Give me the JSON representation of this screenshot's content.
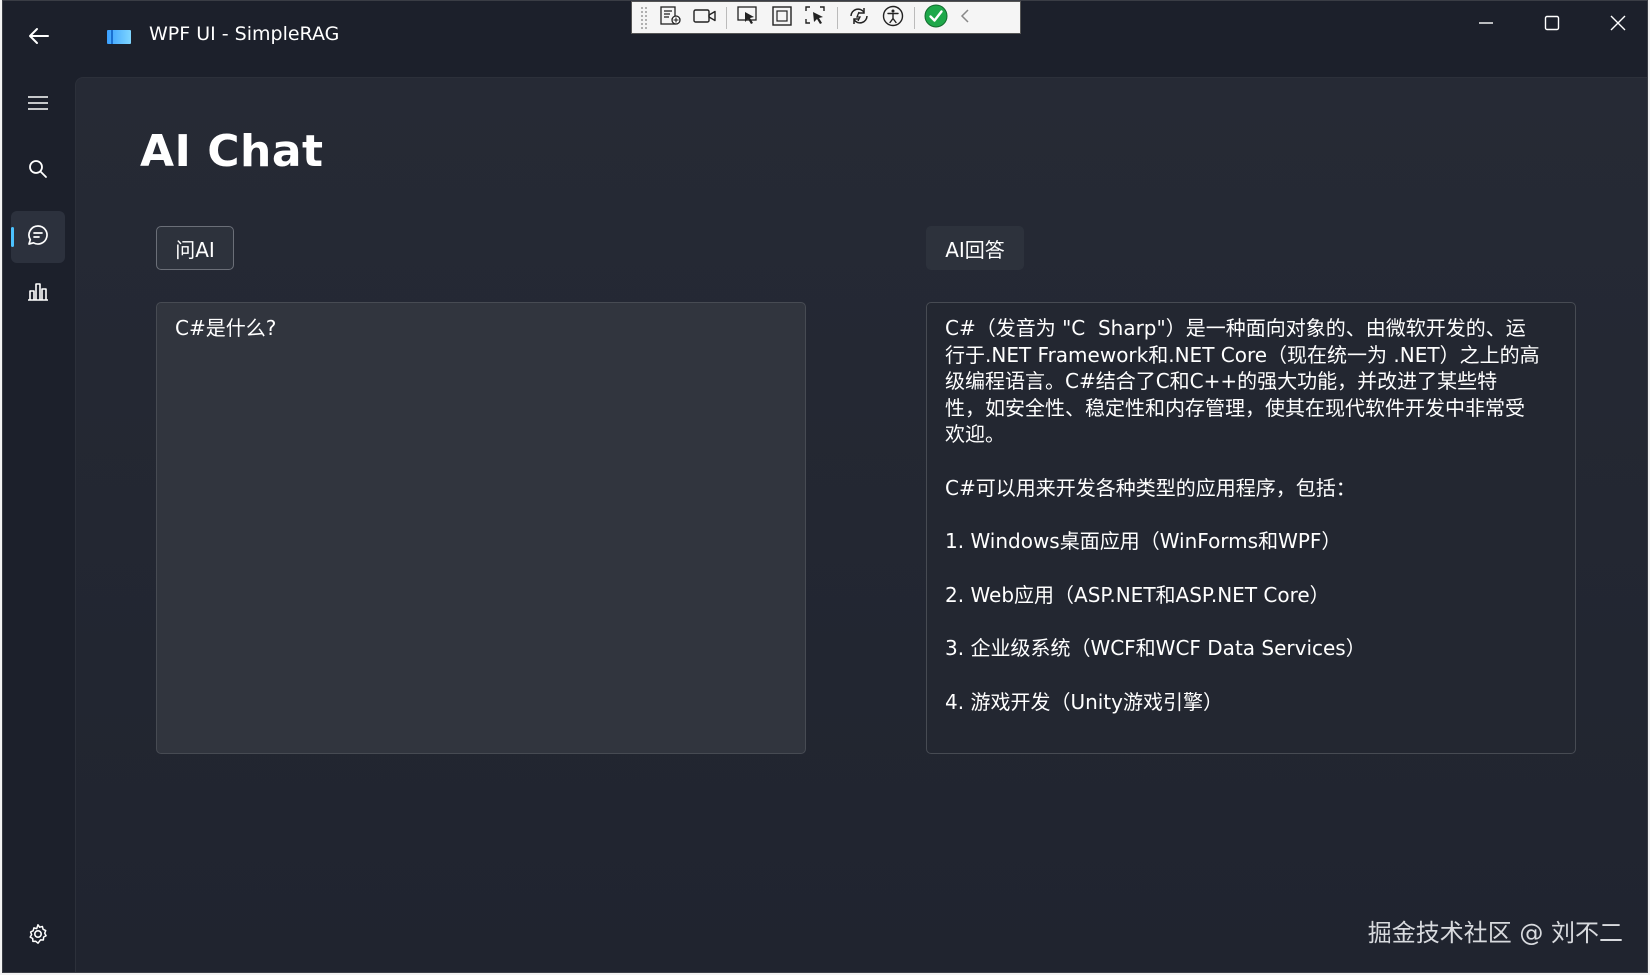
{
  "window": {
    "title": "WPF UI - SimpleRAG"
  },
  "titlebar": {
    "back_icon": "arrow-left-icon",
    "logo_icon": "app-logo-icon",
    "minimize_icon": "minimize-icon",
    "maximize_icon": "maximize-icon",
    "close_icon": "close-icon"
  },
  "debug_toolbar": {
    "items": [
      "live-visual-tree-icon",
      "record-icon",
      "select-element-icon",
      "display-layout-adorners-icon",
      "track-focused-element-icon",
      "hot-reload-icon",
      "accessibility-icon",
      "status-ok-icon",
      "collapse-chevron-icon"
    ]
  },
  "navigation": {
    "items": [
      {
        "icon": "hamburger-menu-icon",
        "active": false
      },
      {
        "icon": "search-icon",
        "active": false
      },
      {
        "icon": "chat-icon",
        "active": true
      },
      {
        "icon": "bar-chart-icon",
        "active": false
      }
    ],
    "footer_icon": "settings-gear-icon"
  },
  "page": {
    "title": "AI Chat",
    "ask_button_label": "问AI",
    "answer_button_label": "AI回答",
    "question_text": "C#是什么?",
    "answer_lines": [
      "C#（发音为 \"C  Sharp\"）是一种面向对象的、由微软开发的、运",
      "行于.NET Framework和.NET Core（现在统一为 .NET）之上的高",
      "级编程语言。C#结合了C和C++的强大功能，并改进了某些特",
      "性，如安全性、稳定性和内存管理，使其在现代软件开发中非常受",
      "欢迎。",
      "",
      "C#可以用来开发各种类型的应用程序，包括：",
      "",
      "1. Windows桌面应用（WinForms和WPF）",
      "",
      "2. Web应用（ASP.NET和ASP.NET Core）",
      "",
      "3. 企业级系统（WCF和WCF Data Services）",
      "",
      "4. 游戏开发（Unity游戏引擎）"
    ]
  },
  "watermark": "掘金技术社区 @ 刘不二",
  "colors": {
    "window_bg": "#1c202b",
    "accent": "#4cc2ff",
    "text": "#ffffff"
  }
}
